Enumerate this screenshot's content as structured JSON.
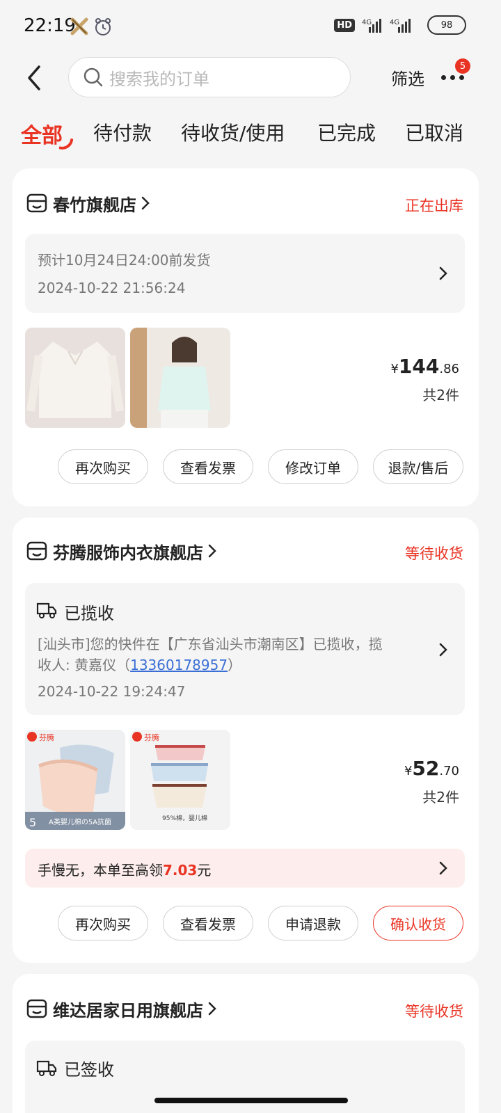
{
  "status_bar": {
    "time": "22:19",
    "hd": "HD",
    "signal": "4G 4G",
    "battery": "98"
  },
  "header": {
    "search_placeholder": "搜索我的订单",
    "filter_label": "筛选",
    "more_badge": "5"
  },
  "tabs": [
    {
      "label": "全部",
      "active": true
    },
    {
      "label": "待付款",
      "active": false
    },
    {
      "label": "待收货/使用",
      "active": false
    },
    {
      "label": "已完成",
      "active": false
    },
    {
      "label": "已取消",
      "active": false
    }
  ],
  "orders": [
    {
      "shop": "春竹旗舰店",
      "status": "正在出库",
      "info_line1": "预计10月24日24:00前发货",
      "info_line2": "2024-10-22 21:56:24",
      "price_currency": "¥",
      "price_int": "144",
      "price_dec": ".86",
      "count": "共2件",
      "buttons": [
        "再次购买",
        "查看发票",
        "修改订单",
        "退款/售后"
      ]
    },
    {
      "shop": "芬腾服饰内衣旗舰店",
      "status": "等待收货",
      "logistics_title": "已揽收",
      "logistics_line1": "[汕头市]您的快件在【广东省汕头市潮南区】已揽收，揽",
      "logistics_line2_prefix": "收人: 黄嘉仪（",
      "logistics_phone": "13360178957",
      "logistics_line2_suffix": "）",
      "logistics_time": "2024-10-22 19:24:47",
      "thumb1_brand": "芬腾",
      "thumb1_caption": "A类婴儿棉の5A抗菌",
      "thumb1_count": "5",
      "thumb2_brand": "芬腾",
      "thumb2_caption": "95%棉，婴儿棉",
      "price_currency": "¥",
      "price_int": "52",
      "price_dec": ".70",
      "count": "共2件",
      "promo_prefix": "手慢无，本单至高领",
      "promo_amount": "7.03",
      "promo_suffix": "元",
      "buttons": [
        "再次购买",
        "查看发票",
        "申请退款",
        "确认收货"
      ]
    },
    {
      "shop": "维达居家日用旗舰店",
      "status": "等待收货",
      "logistics_title": "已签收"
    }
  ]
}
